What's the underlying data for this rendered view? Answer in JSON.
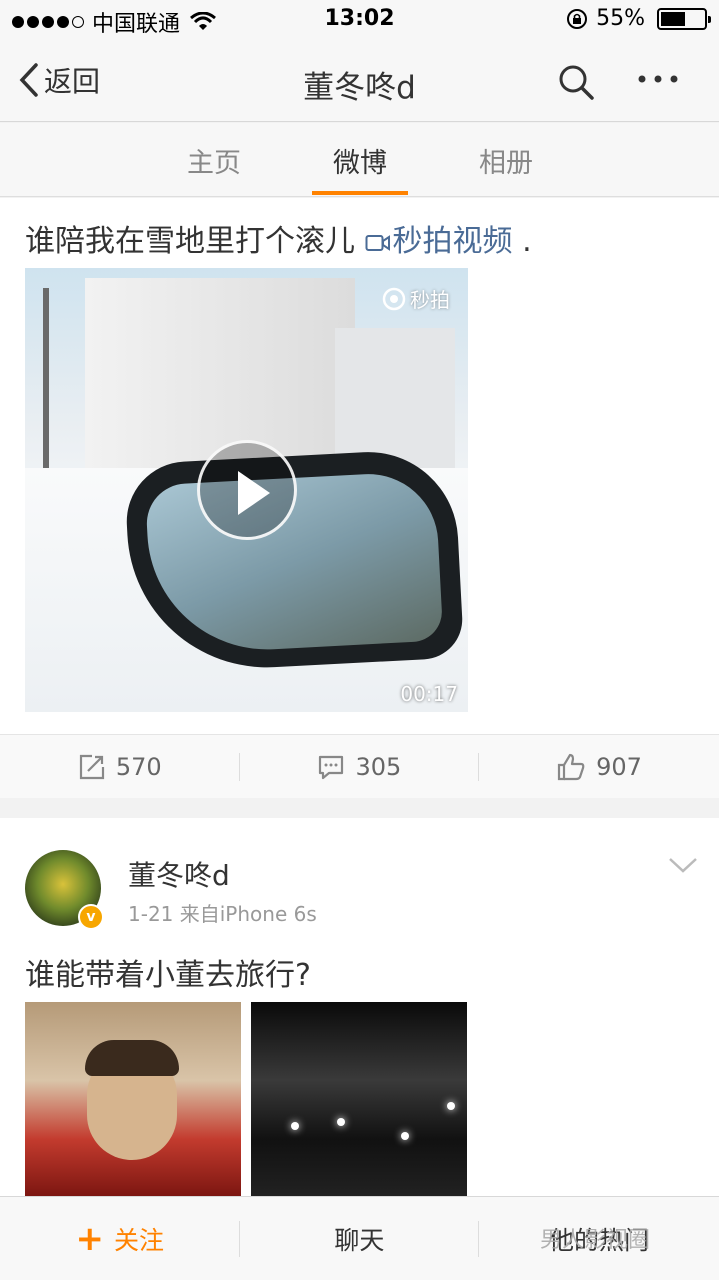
{
  "status_bar": {
    "carrier": "中国联通",
    "time": "13:02",
    "battery_percent": "55%",
    "battery_level": 0.55
  },
  "nav": {
    "back_label": "返回",
    "title": "董冬咚d"
  },
  "tabs": [
    {
      "label": "主页"
    },
    {
      "label": "微博"
    },
    {
      "label": "相册"
    }
  ],
  "post1": {
    "text": "谁陪我在雪地里打个滚儿",
    "video_link": "秒拍视频",
    "trailing": ".",
    "video_brand": "秒拍",
    "duration": "00:17",
    "reposts": "570",
    "comments": "305",
    "likes": "907"
  },
  "post2": {
    "author": "董冬咚d",
    "meta": "1-21  来自iPhone 6s",
    "text": "谁能带着小董去旅行?"
  },
  "bottom": {
    "follow_label": "关注",
    "chat_label": "聊天",
    "hot_label": "他的热门"
  },
  "watermark": "男人影视圈",
  "colors": {
    "accent": "#ff8200",
    "link": "#4a6b96"
  }
}
